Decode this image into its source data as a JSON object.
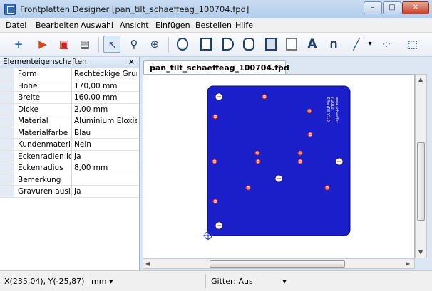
{
  "window": {
    "title": "Frontplatten Designer [pan_tilt_schaeffeag_100704.fpd]",
    "min": "–",
    "max": "□",
    "close": "✕"
  },
  "menu": [
    "Datei",
    "Bearbeiten",
    "Auswahl",
    "Ansicht",
    "Einfügen",
    "Bestellen",
    "Hilfe"
  ],
  "toolbar_icons": {
    "new": "+",
    "open": "▶",
    "save": "▣",
    "print": "▤",
    "select": "↖",
    "zoom": "⚲",
    "crosshair": "⊕",
    "text": "A",
    "curve": "∩",
    "line": "╱",
    "dropdown": "▾",
    "dots": "·:·",
    "frame": "⬚"
  },
  "properties": {
    "header": "Elementeigenschaften",
    "close": "✕",
    "rows": [
      {
        "key": "Form",
        "value": "Rechteckige Grundp"
      },
      {
        "key": "Höhe",
        "value": "170,00 mm"
      },
      {
        "key": "Breite",
        "value": "160,00 mm"
      },
      {
        "key": "Dicke",
        "value": "2,00 mm"
      },
      {
        "key": "Material",
        "value": "Aluminium Eloxiert"
      },
      {
        "key": "Materialfarbe",
        "value": "Blau"
      },
      {
        "key": "Kundenmaterial",
        "value": "Nein"
      },
      {
        "key": "Eckenradien ider",
        "value": "Ja"
      },
      {
        "key": "Eckenradius",
        "value": "8,00 mm"
      },
      {
        "key": "Bemerkung",
        "value": ""
      },
      {
        "key": "Gravuren ausleg",
        "value": "Ja"
      }
    ]
  },
  "document": {
    "tab_label": "pan_tilt_schaeffeag_100704.fpd",
    "tab_close": "✕",
    "panel_color": "#1a1fc9",
    "engraving": [
      "Z-PanTilt V1.0",
      "7.2010",
      "www.schaeffer"
    ]
  },
  "status": {
    "coords": "X(235,04), Y(-25,87)",
    "unit": "mm",
    "unit_arrow": "▾",
    "grid": "Gitter: Aus",
    "grid_arrow": "▾"
  },
  "colors": {
    "accent": "#2d6bc4",
    "hole_marker": "#d21e1e",
    "hole_fill": "#ffffff"
  }
}
